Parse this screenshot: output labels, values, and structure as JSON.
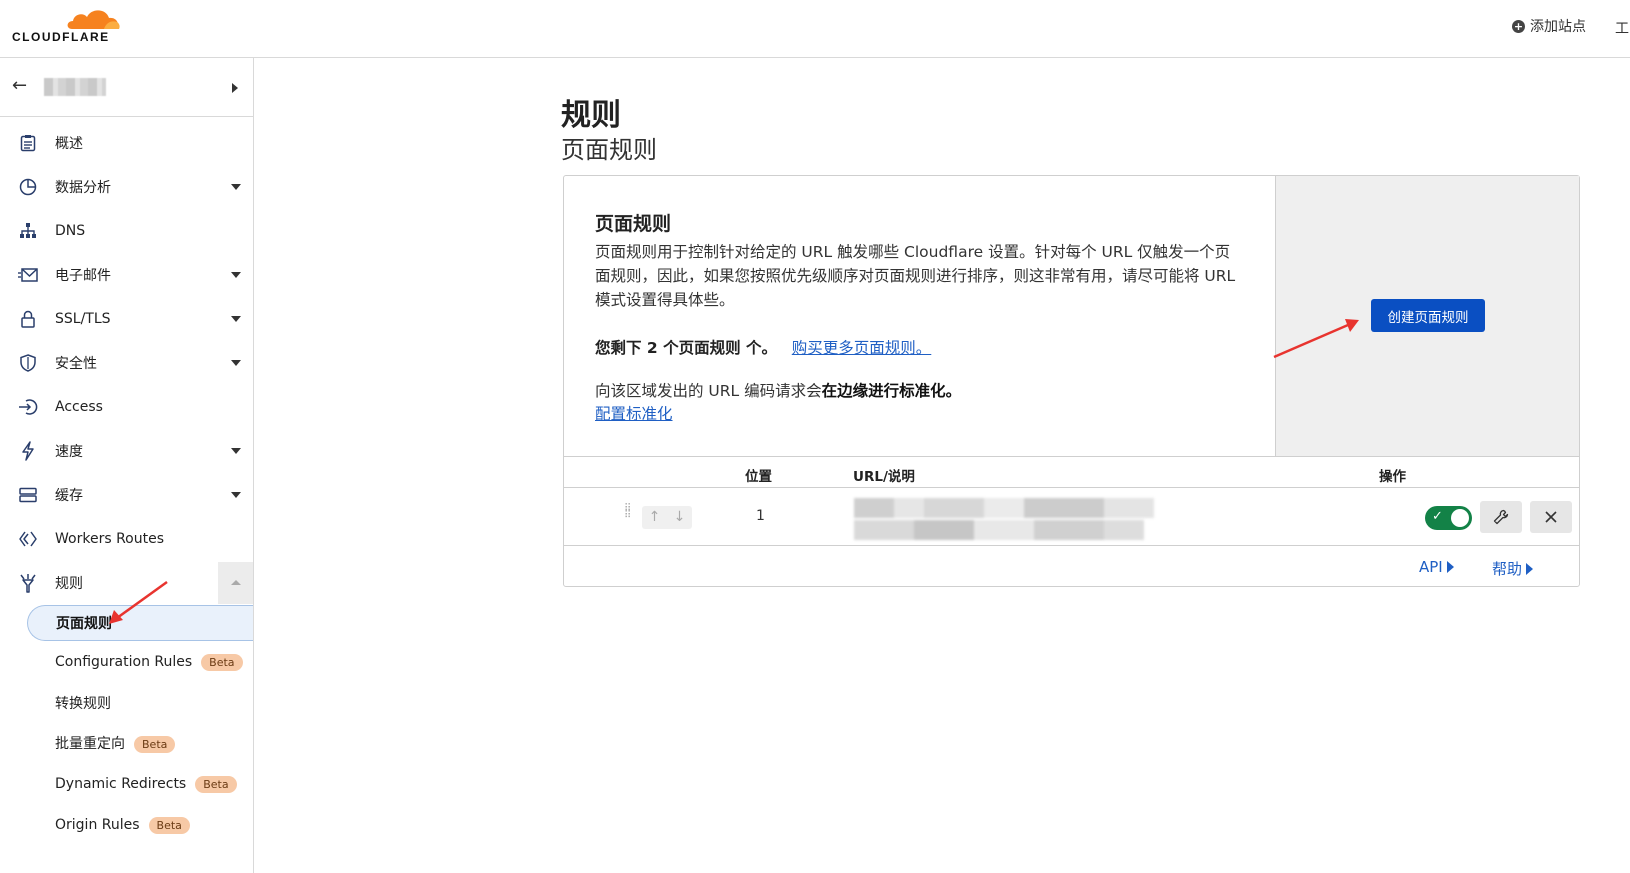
{
  "brand": {
    "name": "CLOUDFLARE",
    "orange": "#f6821f",
    "accent": "#0a4fc2"
  },
  "header": {
    "add_site": "添加站点",
    "edge_text": "工"
  },
  "sidebar": {
    "items": [
      {
        "label": "概述",
        "icon": "clipboard-icon"
      },
      {
        "label": "数据分析",
        "icon": "pie-chart-icon"
      },
      {
        "label": "DNS",
        "icon": "network-icon"
      },
      {
        "label": "电子邮件",
        "icon": "mail-icon"
      },
      {
        "label": "SSL/TLS",
        "icon": "lock-icon"
      },
      {
        "label": "安全性",
        "icon": "shield-icon"
      },
      {
        "label": "Access",
        "icon": "login-icon"
      },
      {
        "label": "速度",
        "icon": "lightning-icon"
      },
      {
        "label": "缓存",
        "icon": "storage-icon"
      },
      {
        "label": "Workers Routes",
        "icon": "workers-icon"
      },
      {
        "label": "规则",
        "icon": "rules-icon"
      }
    ],
    "sub_items": [
      {
        "label": "页面规则",
        "active": true
      },
      {
        "label": "Configuration Rules",
        "badge": "Beta"
      },
      {
        "label": "转换规则"
      },
      {
        "label": "批量重定向",
        "badge": "Beta"
      },
      {
        "label": "Dynamic Redirects",
        "badge": "Beta"
      },
      {
        "label": "Origin Rules",
        "badge": "Beta"
      }
    ]
  },
  "main": {
    "title": "规则",
    "subtitle": "页面规则",
    "card": {
      "heading": "页面规则",
      "description": "页面规则用于控制针对给定的 URL 触发哪些 Cloudflare 设置。针对每个 URL 仅触发一个页面规则，因此，如果您按照优先级顺序对页面规则进行排序，则这非常有用，请尽可能将 URL 模式设置得具体些。",
      "quota_prefix": "您剩下 2 个页面规则 个。",
      "buy_more": "购买更多页面规则。",
      "normalize_prefix": "向该区域发出的 URL 编码请求会",
      "normalize_bold": "在边缘进行标准化。",
      "configure_link": "配置标准化",
      "create_button": "创建页面规则"
    },
    "table": {
      "headers": {
        "position": "位置",
        "url": "URL/说明",
        "actions": "操作"
      },
      "rows": [
        {
          "position": "1",
          "enabled": true
        }
      ]
    },
    "footer": {
      "api": "API",
      "help": "帮助"
    }
  }
}
